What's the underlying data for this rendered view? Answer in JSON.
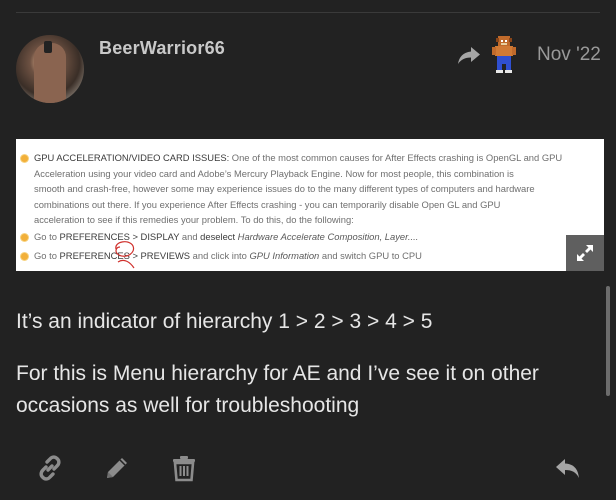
{
  "post": {
    "username": "BeerWarrior66",
    "date": "Nov '22",
    "body_line1": "It’s an indicator of hierarchy 1 > 2 > 3 > 4 > 5",
    "body_line2": "For this is Menu hierarchy for AE and I’ve see it on other",
    "body_line3": "occasions as well for troubleshooting"
  },
  "embed": {
    "heading": "GPU ACCELERATION/VIDEO CARD ISSUES:",
    "p1_rest": " One of the most common causes for After Effects crashing is OpenGL and GPU",
    "p2": "Acceleration using your video card and Adobe’s Mercury Playback Engine. Now for most people, this combination is",
    "p3": "smooth and crash-free, however some may experience issues do to the many different types of computers and hardware",
    "p4": "combinations out there. If you experience After Effects crashing - you can temporarily disable Open GL and GPU",
    "p5": "acceleration to see if this remedies your problem. To do this, do the following:",
    "b1_pre": "Go to ",
    "b1_path": "PREFERENCES > DISPLAY",
    "b1_mid": " and ",
    "b1_action": "deselect",
    "b1_em": " Hardware Accelerate Composition, Layer....",
    "b2_pre": "Go to ",
    "b2_path": "PREFERENCES > PREVIEWS",
    "b2_mid": " and click into ",
    "b2_em": "GPU Information",
    "b2_post": " and switch GPU to CPU"
  },
  "icons": {
    "share": "share-arrow-icon",
    "expand": "expand-icon",
    "link": "link-icon",
    "edit": "pencil-icon",
    "delete": "trash-icon",
    "reply": "reply-icon"
  },
  "colors": {
    "background": "#222222",
    "text": "#e6e6e6",
    "muted": "#9a9a9a",
    "bullet": "#f2b03a"
  }
}
